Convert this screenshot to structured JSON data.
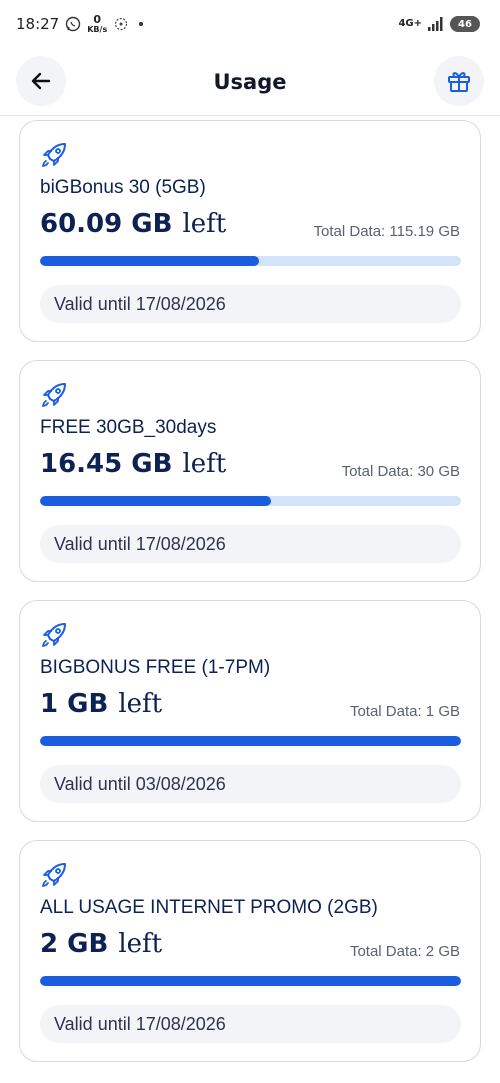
{
  "status_bar": {
    "time": "18:27",
    "net_speed_value": "0",
    "net_speed_unit": "KB/s",
    "network_type": "4G+",
    "battery": "46"
  },
  "header": {
    "title": "Usage"
  },
  "packages": [
    {
      "name": "biGBonus 30 (5GB)",
      "remaining": "60.09 GB",
      "left_word": "left",
      "total": "Total Data: 115.19 GB",
      "remaining_fraction": 0.52,
      "valid": "Valid until 17/08/2026"
    },
    {
      "name": "FREE 30GB_30days",
      "remaining": "16.45 GB",
      "left_word": "left",
      "total": "Total Data: 30 GB",
      "remaining_fraction": 0.548,
      "valid": "Valid until 17/08/2026"
    },
    {
      "name": "BIGBONUS FREE (1-7PM)",
      "remaining": "1 GB",
      "left_word": "left",
      "total": "Total Data: 1 GB",
      "remaining_fraction": 1.0,
      "valid": "Valid until 03/08/2026"
    },
    {
      "name": "ALL USAGE INTERNET PROMO (2GB)",
      "remaining": "2 GB",
      "left_word": "left",
      "total": "Total Data: 2 GB",
      "remaining_fraction": 1.0,
      "valid": "Valid until 17/08/2026"
    }
  ],
  "colors": {
    "accent": "#1a5ddd",
    "bar_track": "#d3e3fa",
    "text_primary": "#0d2152"
  },
  "icons": {
    "back": "arrow-left-icon",
    "gift": "gift-icon",
    "package": "rocket-icon"
  }
}
